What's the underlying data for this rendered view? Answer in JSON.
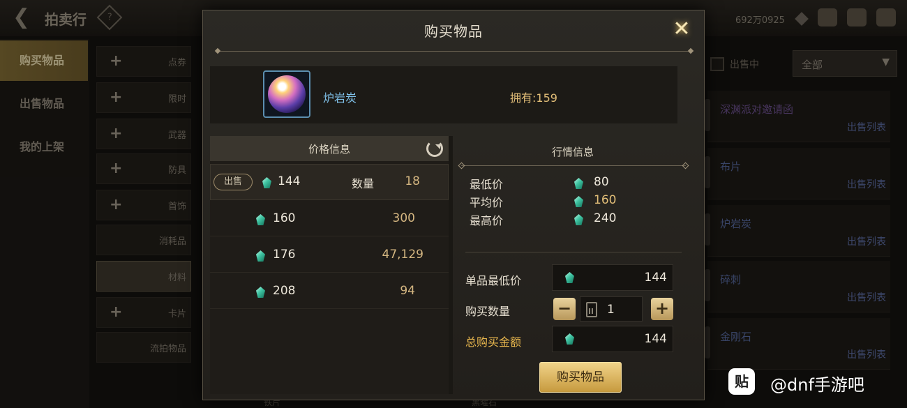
{
  "background": {
    "title": "拍卖行",
    "help_glyph": "?",
    "gold": "692万0925",
    "nav": [
      {
        "label": "购买物品",
        "active": true
      },
      {
        "label": "出售物品",
        "active": false
      },
      {
        "label": "我的上架",
        "active": false
      }
    ],
    "categories": [
      {
        "label": "点券",
        "plus": true
      },
      {
        "label": "限时",
        "plus": true
      },
      {
        "label": "武器",
        "plus": true
      },
      {
        "label": "防具",
        "plus": true
      },
      {
        "label": "首饰",
        "plus": true
      },
      {
        "label": "消耗品",
        "plus": false
      },
      {
        "label": "材料",
        "plus": false,
        "active": true
      },
      {
        "label": "卡片",
        "plus": true
      },
      {
        "label": "流拍物品",
        "plus": false
      }
    ],
    "filter": {
      "on_sale_label": "出售中",
      "dropdown_value": "全部"
    },
    "list": [
      {
        "name": "深渊派对邀请函",
        "link": "出售列表",
        "rarity": "purple"
      },
      {
        "name": "布片",
        "link": "出售列表",
        "rarity": "blue"
      },
      {
        "name": "炉岩炭",
        "link": "出售列表",
        "rarity": "blue"
      },
      {
        "name": "碎刺",
        "link": "出售列表",
        "rarity": "blue"
      },
      {
        "name": "金刚石",
        "link": "出售列表",
        "rarity": "blue"
      }
    ],
    "bottom_peek": [
      "铁片",
      "黑曜石"
    ]
  },
  "modal": {
    "title": "购买物品",
    "close_glyph": "✕",
    "item": {
      "name": "炉岩炭",
      "owned_label": "拥有:",
      "owned_value": "159"
    },
    "price_info": {
      "title": "价格信息",
      "sell_badge": "出售",
      "qty_label": "数量",
      "rows": [
        {
          "price": "144",
          "qty": "18"
        },
        {
          "price": "160",
          "qty": "300"
        },
        {
          "price": "176",
          "qty": "47,129"
        },
        {
          "price": "208",
          "qty": "94"
        }
      ]
    },
    "market": {
      "title": "行情信息",
      "stats": [
        {
          "label": "最低价",
          "value": "80",
          "highlight": false
        },
        {
          "label": "平均价",
          "value": "160",
          "highlight": true
        },
        {
          "label": "最高价",
          "value": "240",
          "highlight": false
        }
      ],
      "unit_min_label": "单品最低价",
      "unit_min_value": "144",
      "buy_qty_label": "购买数量",
      "buy_qty_value": "1",
      "minus_glyph": "−",
      "plus_glyph": "+",
      "total_label": "总购买金额",
      "total_value": "144",
      "buy_button": "购买物品"
    }
  },
  "watermark": {
    "logo": "贴",
    "text": "@dnf手游吧"
  },
  "colors": {
    "accent_gold": "#eab84e",
    "item_name_blue": "#7fc0e8",
    "button_gold": "#c79a3e"
  }
}
